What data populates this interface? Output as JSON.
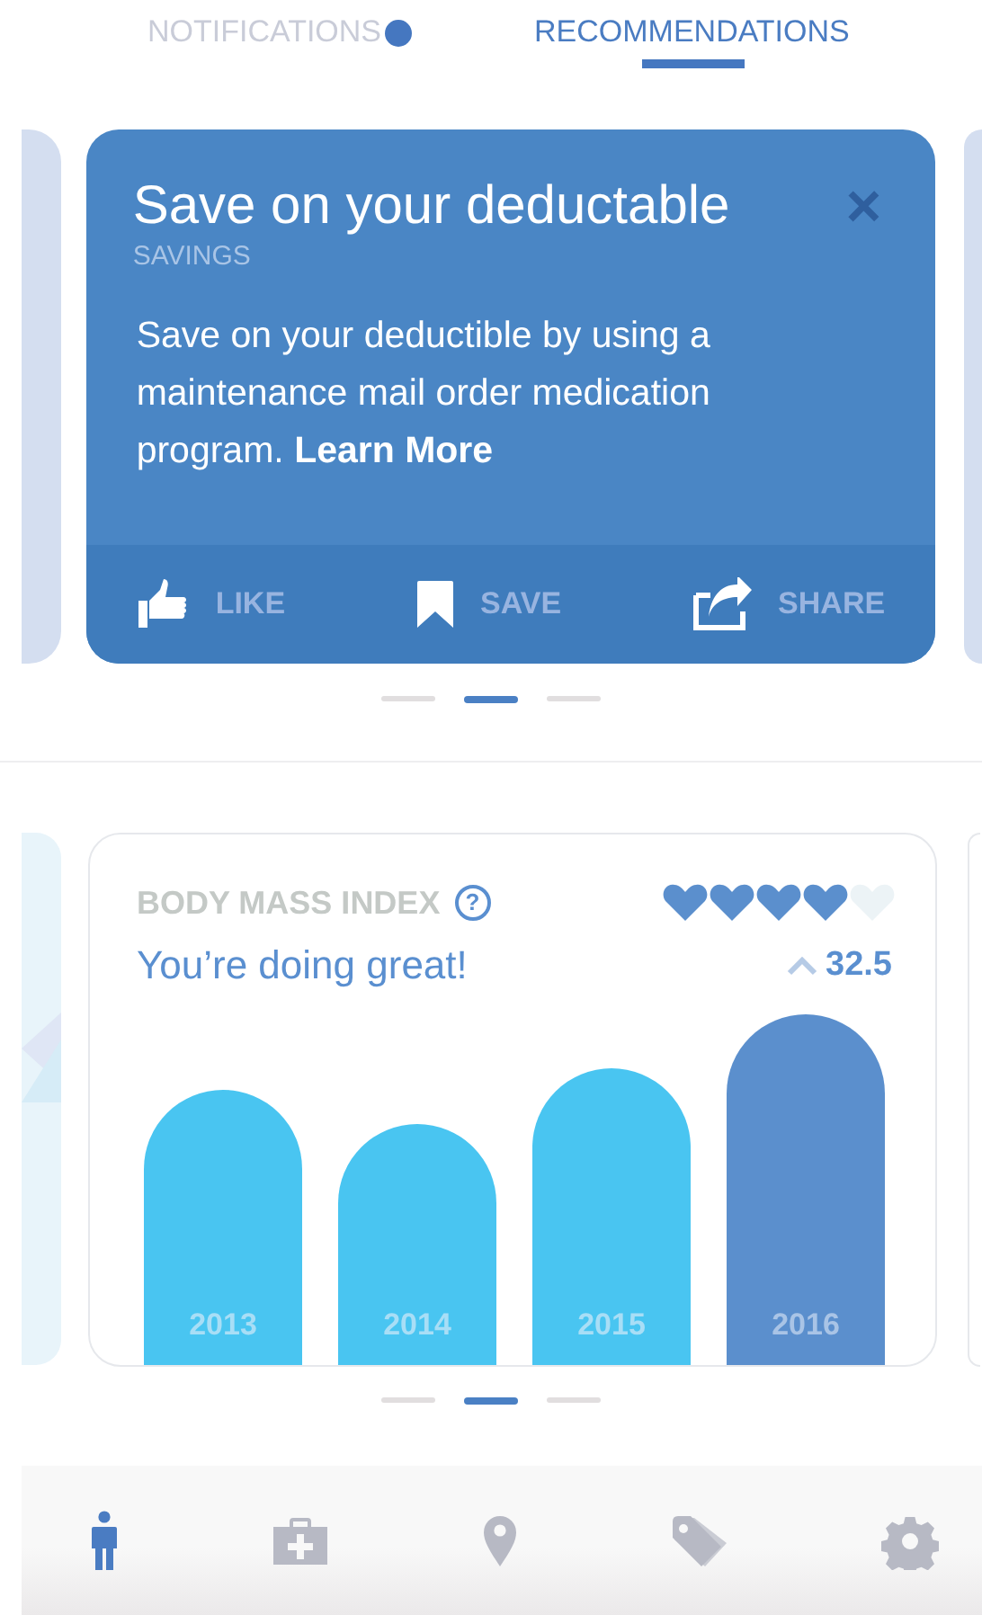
{
  "tabs": [
    {
      "label": "NOTIFICATIONS",
      "selected": false,
      "unread": true
    },
    {
      "label": "RECOMMENDATIONS",
      "selected": true,
      "unread": false
    }
  ],
  "recommendation": {
    "title": "Save on your deductable",
    "category": "SAVINGS",
    "close": "×",
    "body": "Save on your deductible by using a maintenance mail order medication program. **Learn More**",
    "actions": [
      {
        "kind": "like",
        "label": "LIKE"
      },
      {
        "kind": "save",
        "label": "SAVE"
      },
      {
        "kind": "share",
        "label": "SHARE"
      }
    ],
    "pager": [
      {
        "selected": false
      },
      {
        "selected": true
      },
      {
        "selected": false
      }
    ]
  },
  "bmi": {
    "title": "BODY MASS INDEX",
    "help": "?",
    "stars": 4,
    "message": "You’re doing great!",
    "rising": true,
    "value": "32.5",
    "bars": [
      {
        "label": "2013",
        "selected": false
      },
      {
        "label": "2014",
        "selected": false
      },
      {
        "label": "2015",
        "selected": false
      },
      {
        "label": "2016",
        "selected": true
      }
    ],
    "pager": [
      {
        "selected": false
      },
      {
        "selected": true
      },
      {
        "selected": false
      }
    ]
  },
  "nav": [
    {
      "kind": "person",
      "selected": true
    },
    {
      "kind": "medkit",
      "selected": false
    },
    {
      "kind": "pin",
      "selected": false
    },
    {
      "kind": "tag",
      "selected": false
    },
    {
      "kind": "gear",
      "selected": false
    }
  ]
}
